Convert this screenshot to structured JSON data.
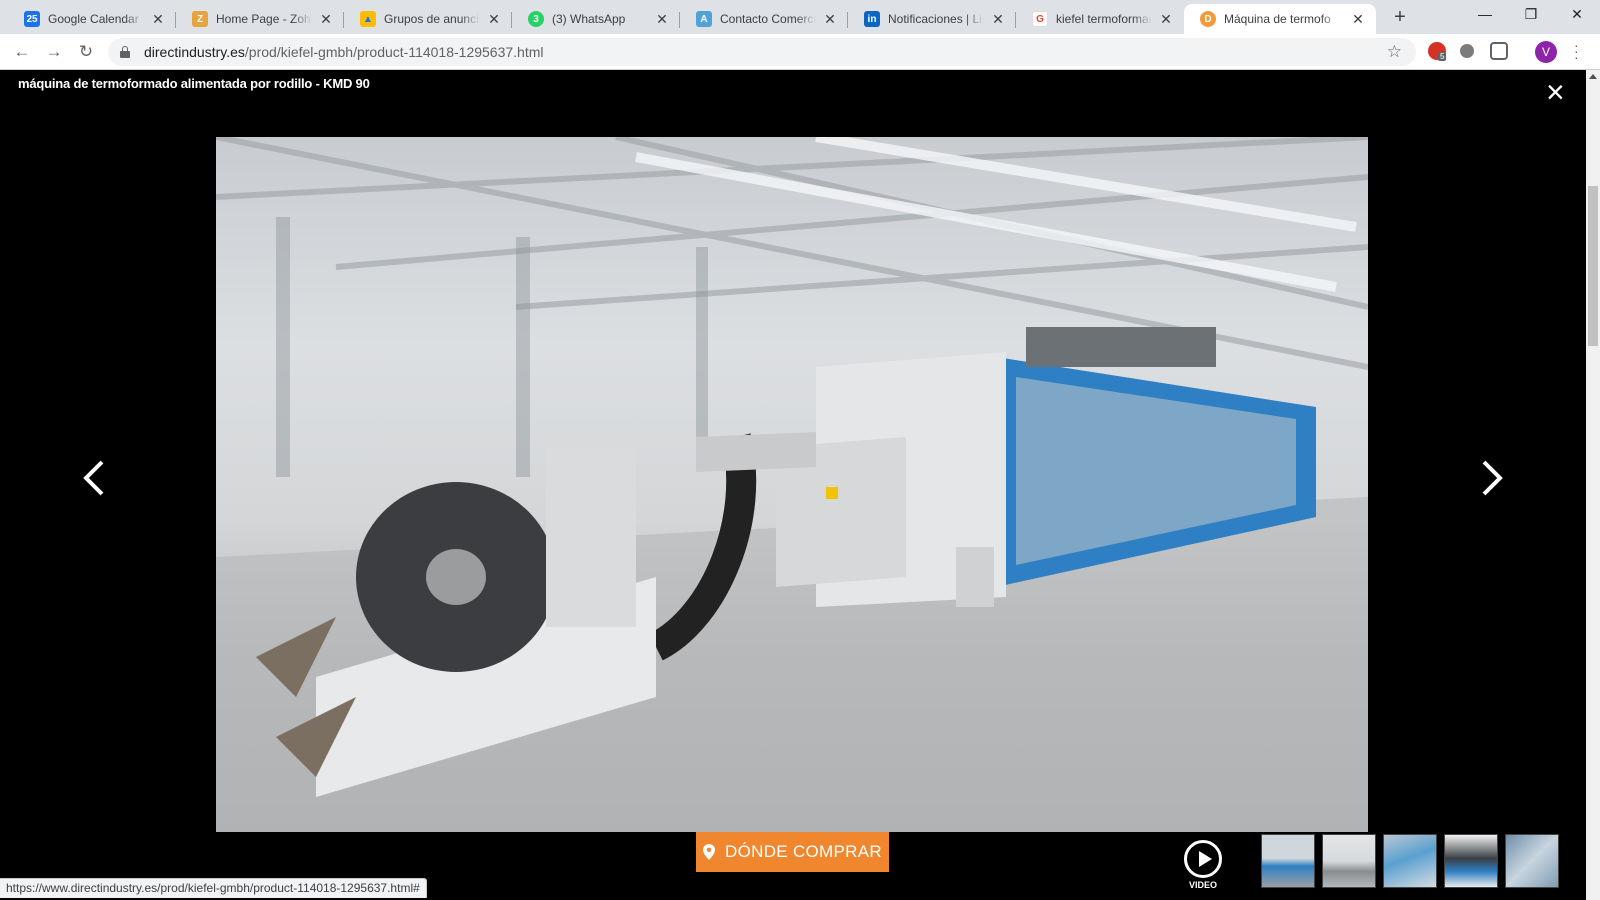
{
  "browser": {
    "tabs": [
      {
        "title": "Google Calendar - S",
        "favicon": "calendar-icon",
        "favicon_text": "25",
        "color": "#1a73e8"
      },
      {
        "title": "Home Page - Zoho C",
        "favicon": "zoho-icon",
        "favicon_text": "Z",
        "color": "#e8a33d"
      },
      {
        "title": "Grupos de anuncios",
        "favicon": "google-ads-icon",
        "favicon_text": "▲",
        "color": "#4285f4"
      },
      {
        "title": "(3) WhatsApp",
        "favicon": "whatsapp-icon",
        "favicon_text": "3",
        "color": "#25d366"
      },
      {
        "title": "Contacto Comercial",
        "favicon": "contact-icon",
        "favicon_text": "A",
        "color": "#4fa3d6"
      },
      {
        "title": "Notificaciones | Link",
        "favicon": "linkedin-icon",
        "favicon_text": "in",
        "color": "#0a66c2"
      },
      {
        "title": "kiefel termoformado",
        "favicon": "google-icon",
        "favicon_text": "G",
        "color": "#ea4335"
      },
      {
        "title": "Máquina de termofo",
        "favicon": "directindustry-icon",
        "favicon_text": "D",
        "color": "#f29b38"
      }
    ],
    "active_tab": 7,
    "url_host": "directindustry.es",
    "url_path": "/prod/kiefel-gmbh/product-114018-1295637.html",
    "profile_initial": "V",
    "extension_badge": "5"
  },
  "lightbox": {
    "title": "máquina de termoformado alimentada por rodillo - KMD 90",
    "buy_button_label": "DÓNDE COMPRAR",
    "video_label": "VIDEO",
    "accent_color": "#f0872e"
  },
  "status_bar": {
    "link_url": "https://www.directindustry.es/prod/kiefel-gmbh/product-114018-1295637.html#"
  }
}
